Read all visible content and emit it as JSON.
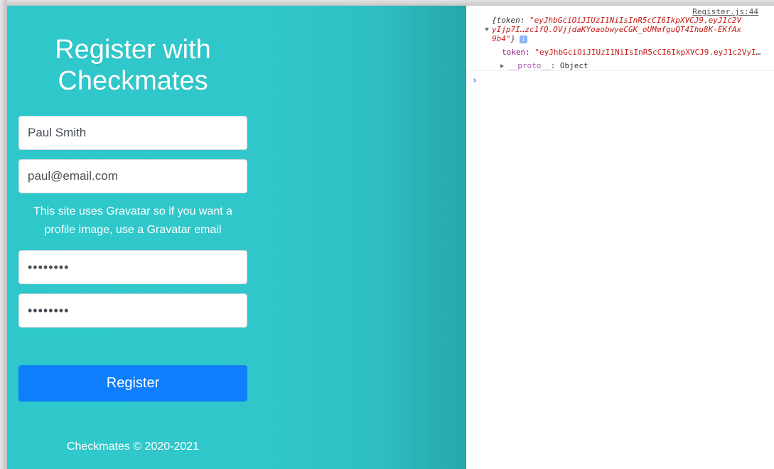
{
  "app": {
    "title": "Register with Checkmates",
    "name_value": "Paul Smith",
    "email_value": "paul@email.com",
    "hint": "This site uses Gravatar so if you want a profile image, use a Gravatar email",
    "password_value": "password",
    "password2_value": "password",
    "register_label": "Register",
    "footer": "Checkmates © 2020-2021"
  },
  "console": {
    "source": "Register.js:44",
    "line1_prefix": "{token: ",
    "line1_str": "\"eyJhbGciOiJIUzI1NiIsInR5cCI6IkpXVCJ9.eyJ1c2V",
    "line2_str": "yIjp7I…zc1fQ.OVjjdaKYoaobwyeCGK_oUMmfguQT4Ihu8K-EKfAx",
    "line3_str": "9b4\"",
    "line3_suffix": "}",
    "info_glyph": "i",
    "prop_key": "token",
    "prop_value": "\"eyJhbGciOiJIUzI1NiIsInR5cCI6IkpXVCJ9.eyJ1c2VyIjp7I…",
    "proto_key": "__proto__",
    "proto_value": "Object",
    "prompt": "›"
  }
}
